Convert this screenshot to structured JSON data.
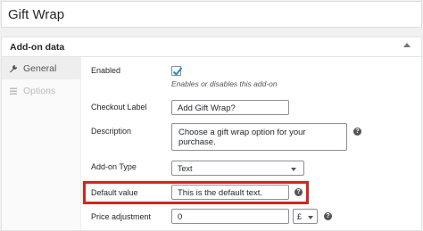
{
  "product_title": "Gift Wrap",
  "panel": {
    "heading": "Add-on data",
    "tabs": [
      {
        "label": "General",
        "icon": "wrench-icon"
      },
      {
        "label": "Options",
        "icon": "list-icon"
      }
    ]
  },
  "fields": {
    "enabled": {
      "label": "Enabled",
      "checked": true,
      "description": "Enables or disables this add-on"
    },
    "checkout_label": {
      "label": "Checkout Label",
      "value": "Add Gift Wrap?"
    },
    "description": {
      "label": "Description",
      "value": "Choose a gift wrap option for your purchase."
    },
    "addon_type": {
      "label": "Add-on Type",
      "value": "Text"
    },
    "default_value": {
      "label": "Default value",
      "value": "This is the default text."
    },
    "price_adjustment": {
      "label": "Price adjustment",
      "value": "0",
      "currency": "£"
    }
  },
  "colors": {
    "highlight": "#d0271d",
    "checkbox": "#1e8cbe"
  }
}
